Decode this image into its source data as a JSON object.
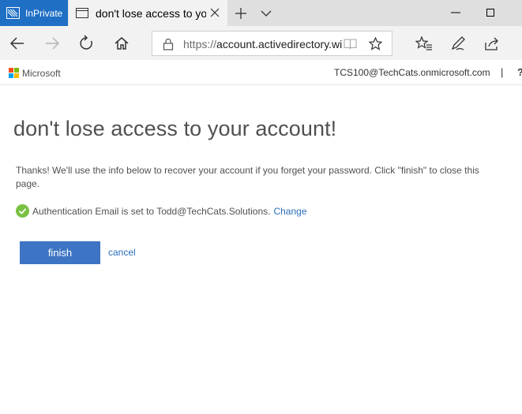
{
  "browser": {
    "inprivate_label": "InPrivate",
    "tab_title": "don't lose access to you",
    "address": {
      "protocol": "https://",
      "host": "account.activedirectory.wi"
    }
  },
  "header": {
    "brand": "Microsoft",
    "user": "TCS100@TechCats.onmicrosoft.com",
    "separator": "|",
    "help": "?"
  },
  "main": {
    "title": "don't lose access to your account!",
    "info": "Thanks! We'll use the info below to recover your account if you forget your password. Click \"finish\" to close this page.",
    "status_text": "Authentication Email is set to Todd@TechCats.Solutions.",
    "status_link": "Change",
    "finish_label": "finish",
    "cancel_label": "cancel"
  },
  "colors": {
    "inprivate_bg": "#1f6fc5",
    "finish_bg": "#3d74c3",
    "link": "#2a6ebb",
    "check": "#7ac142"
  },
  "icons": [
    "inprivate-icon",
    "page-icon",
    "close-icon",
    "new-tab-icon",
    "tab-list-icon",
    "minimize-icon",
    "maximize-icon",
    "back-icon",
    "forward-icon",
    "refresh-icon",
    "home-icon",
    "lock-icon",
    "reading-view-icon",
    "favorite-star-icon",
    "favorites-hub-icon",
    "pen-icon",
    "share-icon",
    "check-icon"
  ]
}
